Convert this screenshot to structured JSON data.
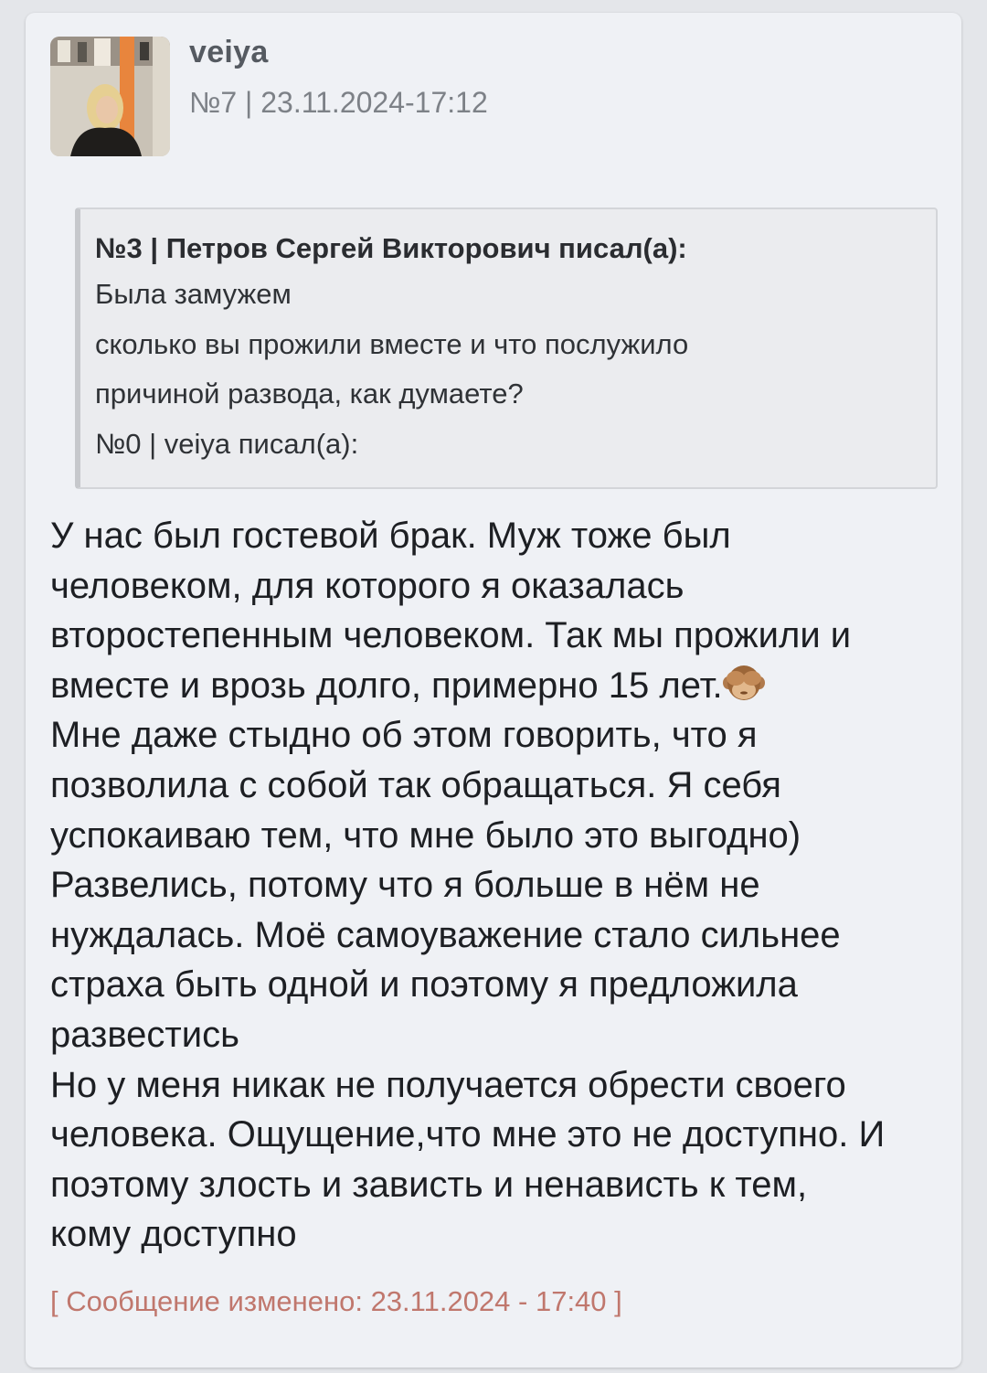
{
  "post": {
    "author": "veiya",
    "meta": "№7 | 23.11.2024-17:12",
    "quote": {
      "header": "№3 | Петров Сергей Викторович писал(а):",
      "lines": [
        "Была замужем",
        "сколько вы прожили вместе и что послужило",
        "причиной развода, как думаете?",
        "№0 | veiya писал(а):"
      ]
    },
    "body_lines": [
      "У нас был гостевой брак. Муж тоже был",
      "человеком, для которого я оказалась",
      "второстепенным человеком. Так мы прожили и",
      "вместе и врозь долго, примерно 15 лет.",
      "Мне даже стыдно об этом говорить, что я",
      "позволила с собой так обращаться. Я себя",
      "успокаиваю тем, что мне было это выгодно)",
      "Развелись, потому что я больше в нём не",
      "нуждалась. Моё самоуважение стало сильнее",
      "страха быть одной и поэтому я предложила",
      "развестись",
      "Но у меня никак не получается обрести своего",
      "человека. Ощущение,что мне это не доступно. И",
      "поэтому злость и зависть и ненависть к тем,",
      "кому доступно"
    ],
    "emoji": "see-no-evil-monkey-icon",
    "edited_note": "[ Сообщение изменено: 23.11.2024 - 17:40 ]"
  },
  "colors": {
    "card_bg": "#eff1f5",
    "quote_bg": "#ebecef",
    "edited_text": "#c0776d"
  }
}
